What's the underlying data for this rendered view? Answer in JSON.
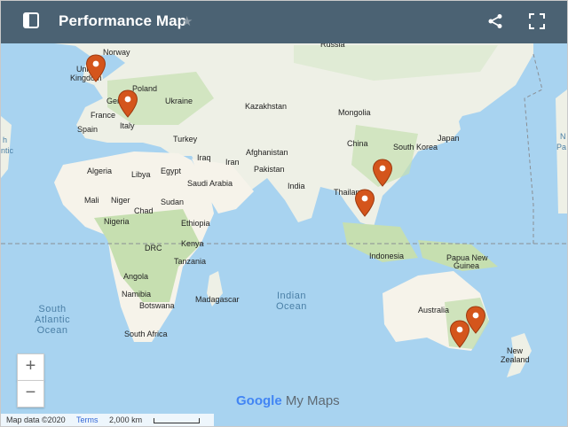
{
  "header": {
    "title": "Performance Map",
    "star_glyph": "★",
    "icons": [
      "sidebar-toggle-icon",
      "share-icon",
      "fullscreen-icon"
    ]
  },
  "labels": {
    "norway": "Norway",
    "uk1": "Uni",
    "uk2": "Kingdom",
    "russia": "Russia",
    "poland": "Poland",
    "germany": "Ger",
    "ukraine": "Ukraine",
    "france": "France",
    "kazakhstan": "Kazakhstan",
    "mongolia": "Mongolia",
    "spain": "Spain",
    "italy": "Italy",
    "turkey": "Turkey",
    "china": "China",
    "south_korea": "South Korea",
    "japan": "Japan",
    "afghanistan": "Afghanistan",
    "iraq": "Iraq",
    "iran": "Iran",
    "pakistan": "Pakistan",
    "algeria": "Algeria",
    "libya": "Libya",
    "egypt": "Egypt",
    "saudi_arabia": "Saudi Arabia",
    "india": "India",
    "thailand": "Thailan",
    "mali": "Mali",
    "niger": "Niger",
    "chad": "Chad",
    "sudan": "Sudan",
    "nigeria": "Nigeria",
    "ethiopia": "Ethiopia",
    "kenya": "Kenya",
    "drc": "DRC",
    "tanzania": "Tanzania",
    "indonesia": "Indonesia",
    "png1": "Papua New",
    "png2": "Guinea",
    "angola": "Angola",
    "namibia": "Namibia",
    "botswana": "Botswana",
    "madagascar": "Madagascar",
    "australia": "Australia",
    "south_africa": "South Africa",
    "new_zealand1": "New",
    "new_zealand2": "Zealand",
    "edge_left1": "h",
    "edge_left2": "ntic",
    "edge_right1": "N",
    "edge_right2": "Pa"
  },
  "oceans": {
    "south_atlantic": [
      "South",
      "Atlantic",
      "Ocean"
    ],
    "indian": [
      "Indian",
      "Ocean"
    ]
  },
  "zoom": {
    "in": "+",
    "out": "−"
  },
  "branding": {
    "google": "Google",
    "mymaps": "My Maps"
  },
  "attribution": {
    "map_data": "Map data ©2020",
    "terms": "Terms",
    "scale": "2,000 km"
  },
  "colors": {
    "header": "#4b6273",
    "water": "#a8d3f0",
    "pin": "#d4551c",
    "land": "#eef0e6",
    "green": "#c6dfb0",
    "desert": "#f6f3ea"
  }
}
